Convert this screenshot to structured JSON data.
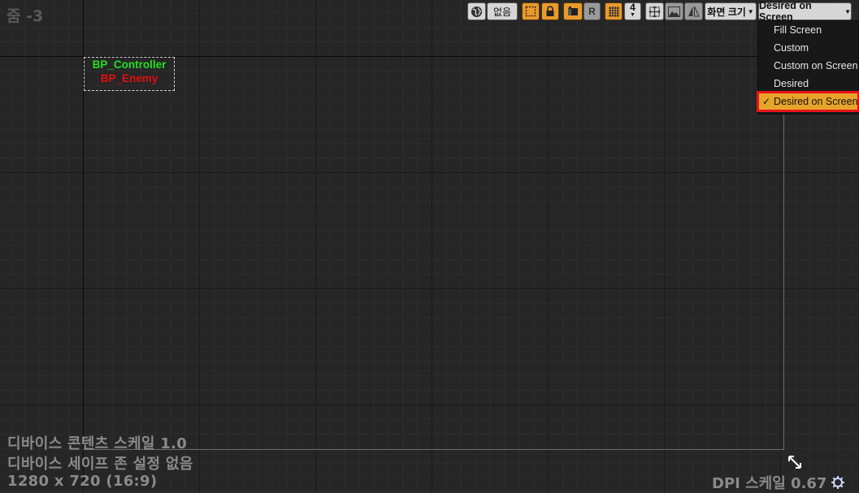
{
  "zoom_label": "줌 -3",
  "widgets": [
    "BP_Controller",
    "BP_Enemy"
  ],
  "toolbar": {
    "globe_icon": "globe-icon",
    "none_label": "없음",
    "r_label": "R",
    "grid_number": "4",
    "screen_size_label": "화면 크기",
    "size_mode_label": "Desired on Screen"
  },
  "menu": {
    "items": [
      "Fill Screen",
      "Custom",
      "Custom on Screen",
      "Desired",
      "Desired on Screen"
    ],
    "selected": "Desired on Screen",
    "check": "✓"
  },
  "info": {
    "line1": "디바이스 콘텐츠 스케일 1.0",
    "line2": "디바이스 세이프 존 설정 없음",
    "line3": "1280 x 720 (16:9)",
    "dpi": "DPI 스케일 0.67"
  },
  "colors": {
    "accent": "#e89a2c",
    "highlight": "#e8131b",
    "widget1": "#22e022",
    "widget2": "#e01010"
  }
}
